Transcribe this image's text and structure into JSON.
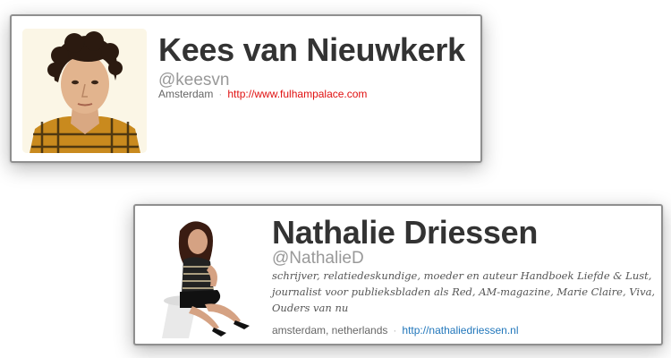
{
  "profile_1": {
    "name": "Kees van Nieuwkerk",
    "handle": "@keesvn",
    "location": "Amsterdam",
    "separator": "·",
    "url": "http://www.fulhampalace.com",
    "link_color": "#e01010"
  },
  "profile_2": {
    "name": "Nathalie Driessen",
    "handle": "@NathalieD",
    "bio": "schrijver, relatiedeskundige, moeder en auteur Handboek Liefde & Lust, journalist voor publieksbladen als Red, AM-magazine, Marie Claire, Viva, Ouders van nu",
    "location": "amsterdam, netherlands",
    "separator": "·",
    "url": "http://nathaliedriessen.nl",
    "link_color": "#2277bb"
  }
}
